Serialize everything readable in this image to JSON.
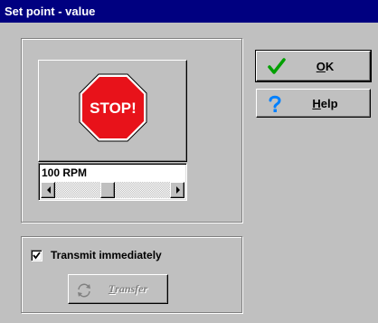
{
  "window": {
    "title": "Set point - value"
  },
  "stop_sign": {
    "text": "STOP!",
    "color": "#e8121a"
  },
  "value_field": {
    "value": "100 RPM",
    "slider_fraction": 0.45
  },
  "buttons": {
    "ok": {
      "mnemonic": "O",
      "rest": "K",
      "icon": "checkmark-icon",
      "icon_color": "#00a000"
    },
    "help": {
      "mnemonic": "H",
      "rest": "elp",
      "icon": "question-mark-icon",
      "icon_color": "#0080ff"
    },
    "transfer": {
      "mnemonic": "T",
      "rest": "ransfer",
      "icon": "transfer-arrows-icon",
      "enabled": false
    }
  },
  "transmit": {
    "label": "Transmit immediately",
    "checked": true
  }
}
